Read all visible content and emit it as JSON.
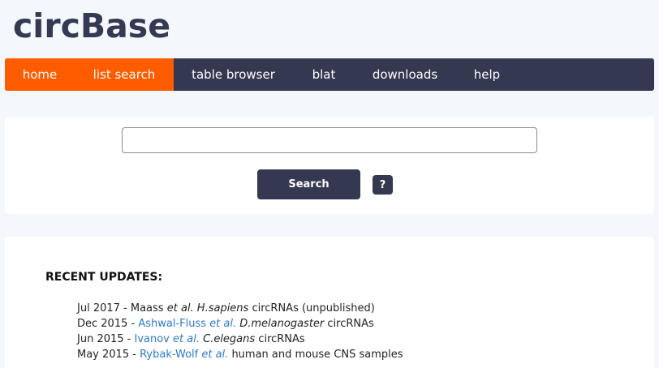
{
  "site": {
    "logo": "circBase"
  },
  "nav": {
    "items": [
      {
        "label": "home"
      },
      {
        "label": "list search"
      },
      {
        "label": "table browser"
      },
      {
        "label": "blat"
      },
      {
        "label": "downloads"
      },
      {
        "label": "help"
      }
    ],
    "active": [
      "home",
      "list search"
    ]
  },
  "search": {
    "value": "",
    "button_label": "Search",
    "help_label": "?"
  },
  "updates": {
    "title": "RECENT UPDATES:",
    "items": [
      {
        "date": "Jul 2017",
        "sep": " - ",
        "author": "Maass",
        "etal": " et al.",
        "species": "H.sapiens",
        "desc": " circRNAs (unpublished)",
        "linked": false
      },
      {
        "date": "Dec 2015",
        "sep": " - ",
        "author": "Ashwal-Fluss",
        "etal": " et al.",
        "species": "D.melanogaster",
        "desc": " circRNAs",
        "linked": true
      },
      {
        "date": "Jun 2015",
        "sep": " - ",
        "author": "Ivanov",
        "etal": " et al.",
        "species": "C.elegans",
        "desc": " circRNAs",
        "linked": true
      },
      {
        "date": "May 2015",
        "sep": " - ",
        "author": "Rybak-Wolf",
        "etal": " et al.",
        "species": "",
        "desc": " human and mouse CNS samples",
        "linked": true
      }
    ]
  },
  "colors": {
    "nav_bg": "#343850",
    "nav_active": "#ff5c00",
    "link": "#2b7bc9",
    "page_bg": "#f4f7fc"
  }
}
